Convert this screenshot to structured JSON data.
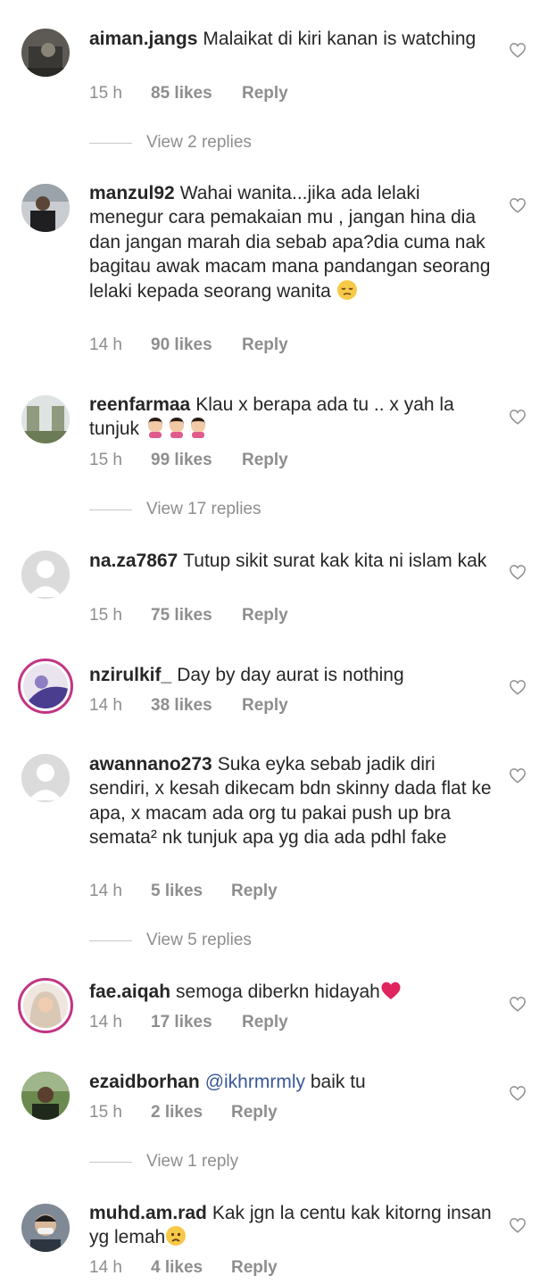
{
  "comments": [
    {
      "username": "aiman.jangs",
      "text": "Malaikat di kiri kanan is watching",
      "time": "15 h",
      "likes": "85 likes",
      "reply": "Reply",
      "view_replies": "View 2 replies"
    },
    {
      "username": "manzul92",
      "text": "Wahai wanita...jika ada lelaki menegur cara pemakaian mu , jangan hina dia dan jangan marah dia sebab apa?dia cuma nak bagitau awak macam mana pandangan seorang lelaki kepada seorang wanita",
      "emoji": "pensive-face-emoji",
      "time": "14 h",
      "likes": "90 likes",
      "reply": "Reply"
    },
    {
      "username": "reenfarmaa",
      "text": "Klau x berapa ada tu .. x yah la tunjuk",
      "emoji": "woman-tipping-hand-emoji x3",
      "time": "15 h",
      "likes": "99 likes",
      "reply": "Reply",
      "view_replies": "View 17 replies"
    },
    {
      "username": "na.za7867",
      "text": "Tutup sikit surat kak kita ni islam kak",
      "time": "15 h",
      "likes": "75 likes",
      "reply": "Reply"
    },
    {
      "username": "nzirulkif_",
      "text": "Day by day aurat is nothing",
      "time": "14 h",
      "likes": "38 likes",
      "reply": "Reply"
    },
    {
      "username": "awannano273",
      "text": "Suka eyka sebab jadik diri sendiri, x kesah dikecam bdn skinny dada flat ke apa, x macam ada org tu pakai push up bra semata² nk tunjuk apa yg dia ada pdhl fake",
      "time": "14 h",
      "likes": "5 likes",
      "reply": "Reply",
      "view_replies": "View 5 replies"
    },
    {
      "username": "fae.aiqah",
      "text": "semoga diberkn hidayah",
      "emoji": "red-heart-emoji",
      "time": "14 h",
      "likes": "17 likes",
      "reply": "Reply"
    },
    {
      "username": "ezaidborhan",
      "mention": "@ikhrmrmly",
      "text": "baik tu",
      "time": "15 h",
      "likes": "2 likes",
      "reply": "Reply",
      "view_replies": "View 1 reply"
    },
    {
      "username": "muhd.am.rad",
      "text": "Kak jgn la centu kak kitorng insan yg lemah",
      "emoji": "worried-face-emoji",
      "time": "14 h",
      "likes": "4 likes",
      "reply": "Reply"
    }
  ],
  "colors": {
    "text": "#262626",
    "muted": "#8e8e8e",
    "mention": "#385898",
    "story_ring": "#c13584",
    "heart_emoji": "#e0245e"
  },
  "icons": {
    "like": "heart-outline-icon"
  }
}
